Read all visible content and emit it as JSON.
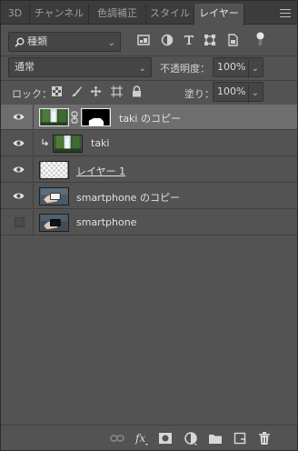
{
  "tabs": [
    {
      "label": "3D",
      "active": false
    },
    {
      "label": "チャンネル",
      "active": false
    },
    {
      "label": "色調補正",
      "active": false
    },
    {
      "label": "スタイル",
      "active": false
    },
    {
      "label": "レイヤー",
      "active": true
    }
  ],
  "filter": {
    "kind_label": "種類",
    "icons": [
      "pixel-filter-icon",
      "adjustment-filter-icon",
      "type-filter-icon",
      "shape-filter-icon",
      "smart-object-filter-icon"
    ]
  },
  "blend": {
    "mode": "通常",
    "opacity_label": "不透明度：",
    "opacity_value": "100%"
  },
  "lock": {
    "label": "ロック：",
    "fill_label": "塗り：",
    "fill_value": "100%"
  },
  "layers": [
    {
      "name": "taki のコピー",
      "visible": true,
      "selected": true,
      "clipped": false,
      "has_mask": true,
      "thumb": "waterfall"
    },
    {
      "name": "taki",
      "visible": true,
      "selected": false,
      "clipped": true,
      "has_mask": false,
      "thumb": "waterfall"
    },
    {
      "name": "レイヤー 1",
      "visible": true,
      "selected": false,
      "clipped": false,
      "has_mask": false,
      "thumb": "transparent"
    },
    {
      "name": "smartphone のコピー",
      "visible": true,
      "selected": false,
      "clipped": false,
      "has_mask": false,
      "thumb": "hand-phone"
    },
    {
      "name": "smartphone",
      "visible": false,
      "selected": false,
      "clipped": false,
      "has_mask": false,
      "thumb": "hand-phone-dark"
    }
  ],
  "bottom_icons": [
    "link-layers-icon",
    "fx-icon",
    "add-mask-icon",
    "adjustment-layer-icon",
    "new-group-icon",
    "new-layer-icon",
    "delete-layer-icon"
  ],
  "colors": {
    "panel": "#535353",
    "selected_row": "#6e6e6e",
    "tabbar": "#3c3c3c"
  }
}
